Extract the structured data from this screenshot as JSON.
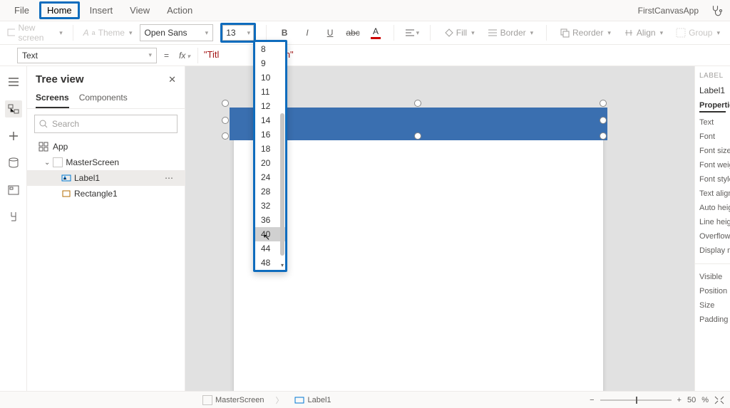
{
  "menubar": {
    "items": [
      "File",
      "Home",
      "Insert",
      "View",
      "Action"
    ],
    "active_index": 1,
    "app_name": "FirstCanvasApp"
  },
  "ribbon": {
    "new_screen": "New screen",
    "theme": "Theme",
    "font_name": "Open Sans",
    "font_size": "13",
    "fill": "Fill",
    "border": "Border",
    "reorder": "Reorder",
    "align": "Align",
    "group": "Group"
  },
  "formula": {
    "property": "Text",
    "eq": "=",
    "fx": "fx",
    "value_prefix": "\"Titl",
    "value_suffix": "Screen\""
  },
  "tree": {
    "title": "Tree view",
    "tabs": [
      "Screens",
      "Components"
    ],
    "active_tab": 0,
    "search_placeholder": "Search",
    "app_label": "App",
    "nodes": [
      {
        "label": "MasterScreen",
        "depth": 1,
        "icon": "screen",
        "selected": false
      },
      {
        "label": "Label1",
        "depth": 2,
        "icon": "label",
        "selected": true
      },
      {
        "label": "Rectangle1",
        "depth": 2,
        "icon": "rect",
        "selected": false
      }
    ]
  },
  "font_sizes": [
    "8",
    "9",
    "10",
    "11",
    "12",
    "14",
    "16",
    "18",
    "20",
    "24",
    "28",
    "32",
    "36",
    "40",
    "44",
    "48"
  ],
  "font_size_hover_index": 13,
  "props": {
    "category": "LABEL",
    "name": "Label1",
    "tab": "Properties",
    "rows": [
      "Text",
      "Font",
      "Font size",
      "Font weight",
      "Font style",
      "Text alignment",
      "Auto height",
      "Line height",
      "Overflow",
      "Display mode"
    ],
    "rows2": [
      "Visible",
      "Position",
      "Size",
      "Padding"
    ]
  },
  "status": {
    "crumb1": "MasterScreen",
    "crumb2": "Label1",
    "zoom_value": "50",
    "zoom_unit": "%"
  }
}
